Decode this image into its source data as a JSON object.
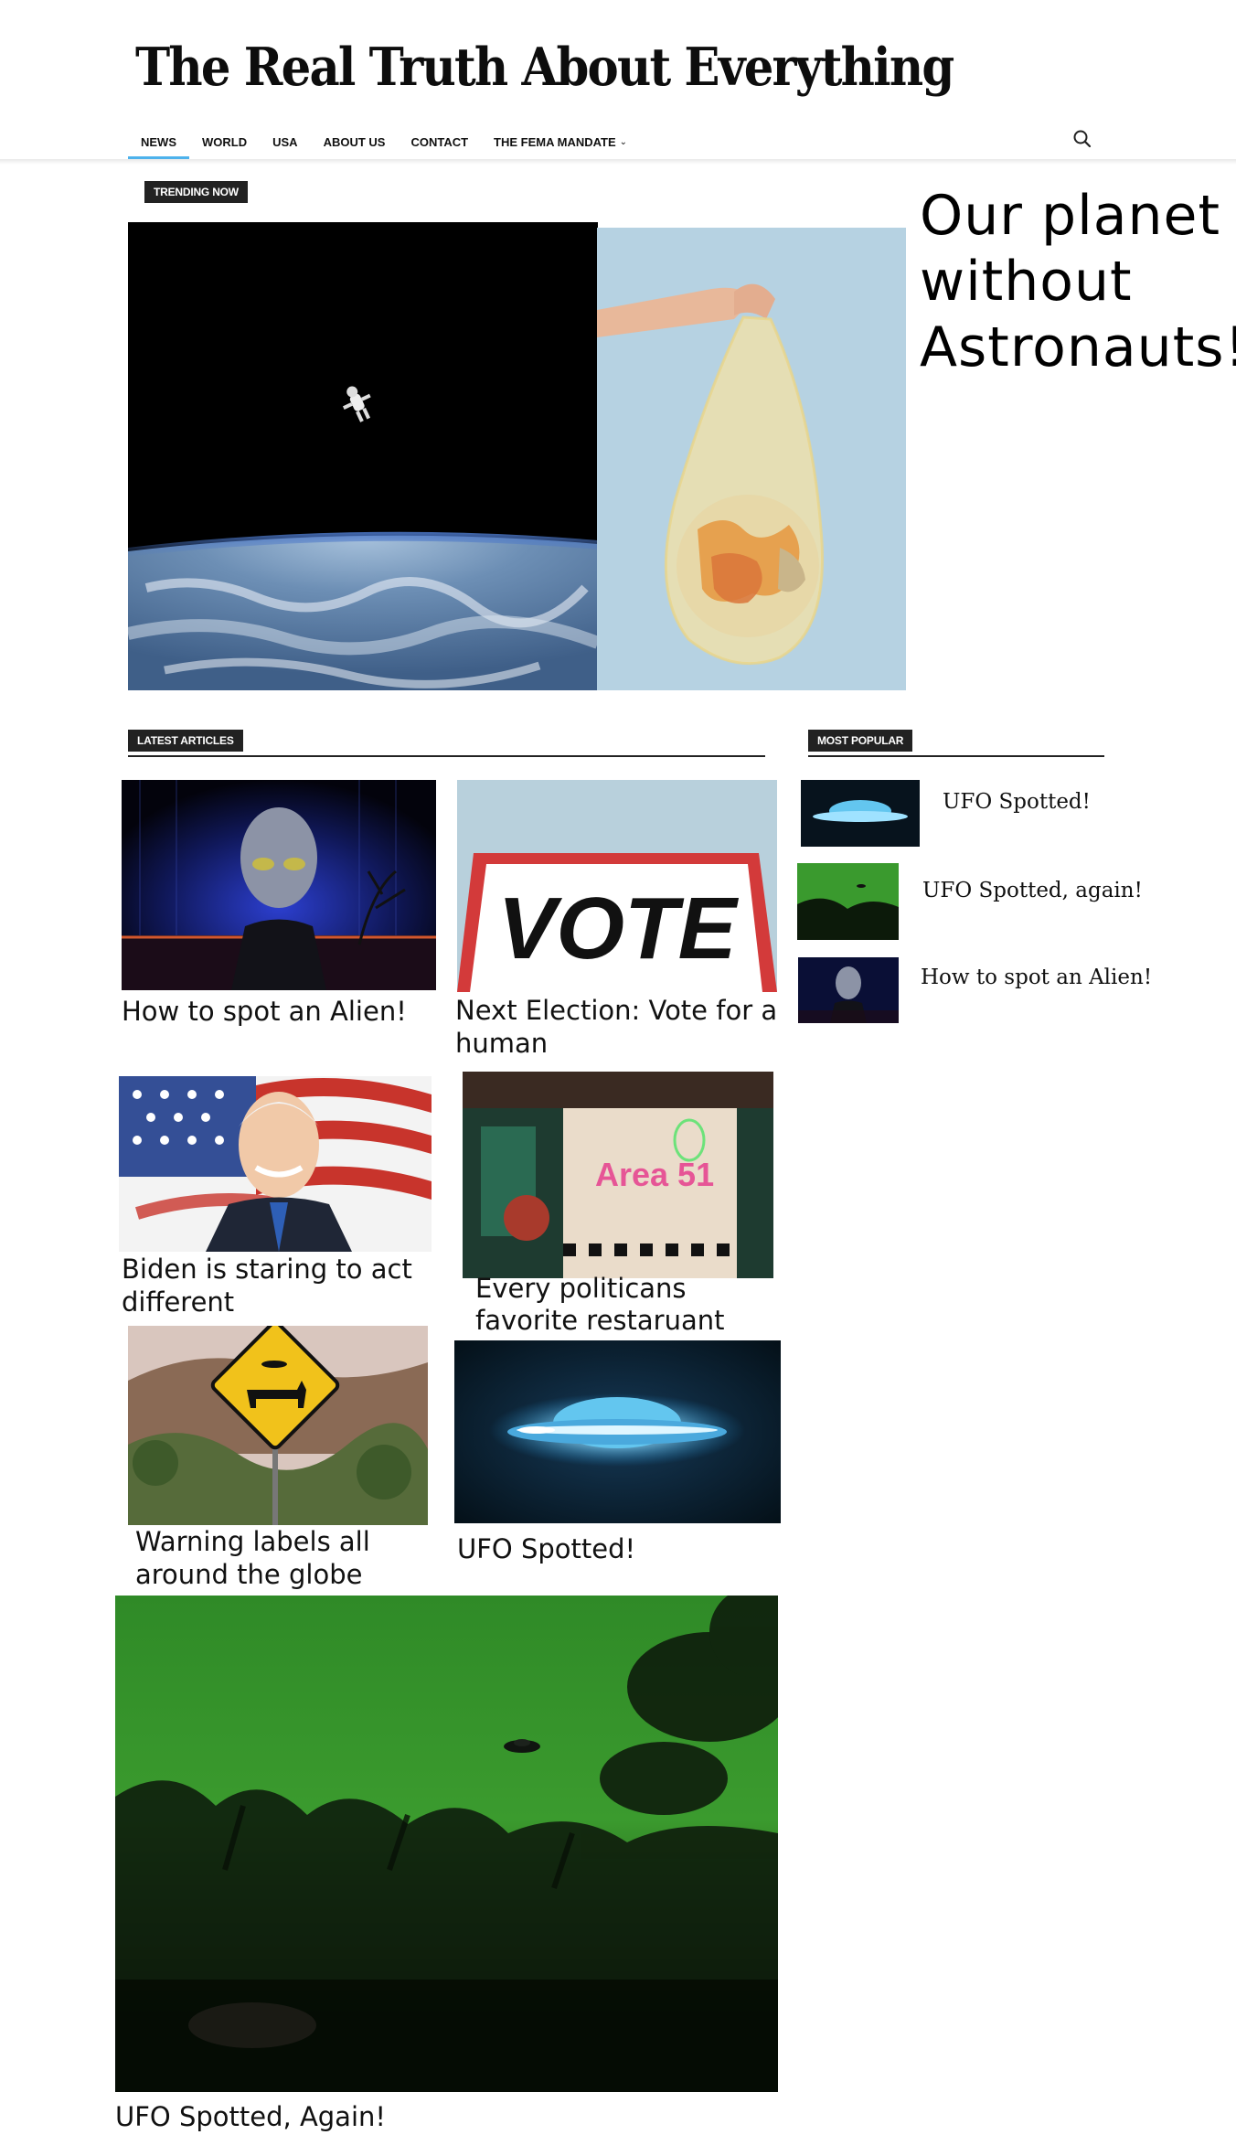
{
  "site": {
    "title": "The Real Truth About Everything"
  },
  "nav": {
    "items": [
      "NEWS",
      "WORLD",
      "USA",
      "ABOUT US",
      "CONTACT",
      "THE FEMA MANDATE"
    ],
    "active": "NEWS"
  },
  "trending": {
    "label": "TRENDING NOW",
    "headline": "Our planet without Astronauts!"
  },
  "latest": {
    "label": "LATEST ARTICLES",
    "articles": [
      {
        "title": "How to spot an Alien!"
      },
      {
        "title": "Next Election: Vote for a human"
      },
      {
        "title": "Biden is staring to act different"
      },
      {
        "title": "Every politicans favorite restaruant"
      },
      {
        "title": "Warning labels all around the globe"
      },
      {
        "title": "UFO Spotted!"
      },
      {
        "title": "UFO Spotted, Again!"
      }
    ]
  },
  "popular": {
    "label": "MOST POPULAR",
    "items": [
      {
        "title": "UFO Spotted!"
      },
      {
        "title": "UFO Spotted, again!"
      },
      {
        "title": "How to spot an Alien!"
      }
    ]
  },
  "images": {
    "vote_sign": "VOTE",
    "neon_sign": "Area 51"
  },
  "colors": {
    "accent": "#4db2ec",
    "label_bg": "#222222"
  },
  "icons": {
    "search": "search-icon",
    "dropdown": "chevron-down-icon"
  }
}
